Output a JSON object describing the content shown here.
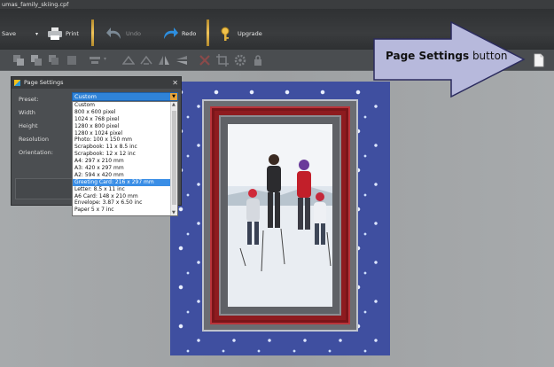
{
  "window": {
    "title": "umas_family_skiing.cpf"
  },
  "toolbar": {
    "save_label": "Save",
    "print_label": "Print",
    "undo_label": "Undo",
    "redo_label": "Redo",
    "upgrade_label": "Upgrade"
  },
  "dialog": {
    "title": "Page Settings",
    "preset_label": "Preset:",
    "width_label": "Width",
    "height_label": "Height",
    "resolution_label": "Resolution",
    "orientation_label": "Orientation:",
    "preset_value": "Custom",
    "options": [
      "Custom",
      "800 x 600 pixel",
      "1024 x 768 pixel",
      "1280 x 800 pixel",
      "1280 x 1024 pixel",
      "Photo: 100 x 150 mm",
      "Scrapbook: 11 x 8.5 inc",
      "Scrapbook: 12 x 12 inc",
      "A4: 297 x 210 mm",
      "A3: 420 x 297 mm",
      "A2: 594 x 420 mm",
      "Greeting Card: 216 x 297 mm",
      "Letter: 8.5 x 11 inc",
      "A6 Card: 148 x 210 mm",
      "Envelope: 3.87 x 6.50 inc",
      "Paper 5 x 7 inc"
    ],
    "selected_index": 11
  },
  "callout": {
    "bold": "Page Settings",
    "rest": " button"
  },
  "colors": {
    "accent": "#3a8ee6",
    "frame_red": "#8e1b1f",
    "canvas_blue": "#3f4fa0",
    "callout_fill": "#b7b9dc"
  }
}
